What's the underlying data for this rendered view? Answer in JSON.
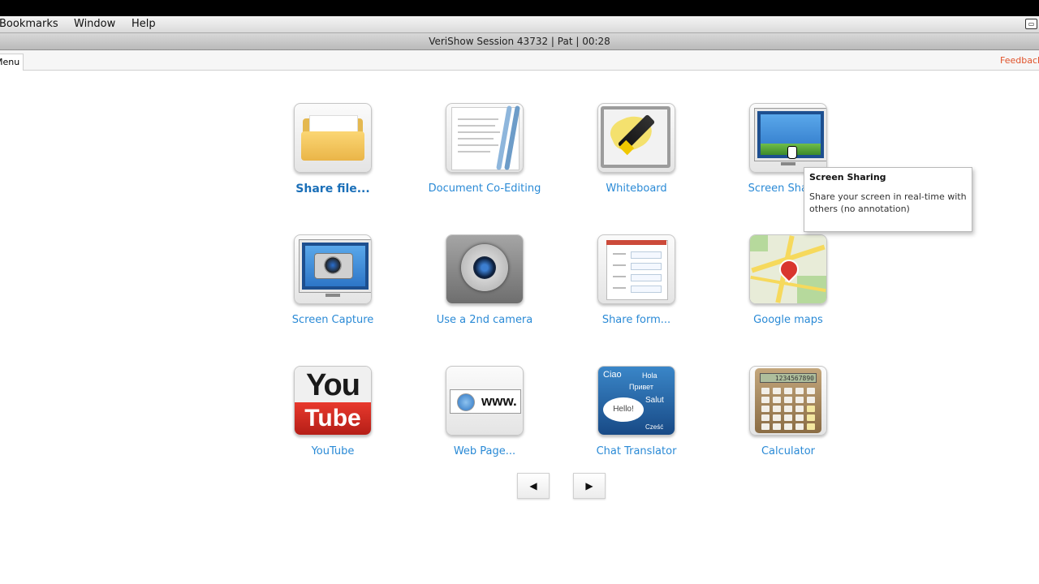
{
  "menubar": {
    "items": [
      "Bookmarks",
      "Window",
      "Help"
    ]
  },
  "titlebar": {
    "title": "VeriShow Session 43732 | Pat | 00:28"
  },
  "tabs": {
    "menu_label": "Menu",
    "feedback_label": "Feedback"
  },
  "apps": [
    {
      "label": "Share file...",
      "icon": "folder-icon"
    },
    {
      "label": "Document Co-Editing",
      "icon": "document-icon"
    },
    {
      "label": "Whiteboard",
      "icon": "whiteboard-icon"
    },
    {
      "label": "Screen Sharing",
      "icon": "monitor-icon"
    },
    {
      "label": "Screen Capture",
      "icon": "camera-screen-icon"
    },
    {
      "label": "Use a 2nd camera",
      "icon": "camera-lens-icon"
    },
    {
      "label": "Share form...",
      "icon": "form-icon"
    },
    {
      "label": "Google maps",
      "icon": "map-icon"
    },
    {
      "label": "YouTube",
      "icon": "youtube-icon"
    },
    {
      "label": "Web Page...",
      "icon": "web-page-icon"
    },
    {
      "label": "Chat Translator",
      "icon": "translator-icon"
    },
    {
      "label": "Calculator",
      "icon": "calculator-icon"
    }
  ],
  "icon_text": {
    "youtube_top": "You",
    "youtube_bottom": "Tube",
    "web": "www.",
    "translator_hello": "Hello!",
    "translator_words": [
      "Ciao",
      "Hola",
      "Привет",
      "Salut",
      "Cześć"
    ],
    "calculator_display": "1234567890"
  },
  "tooltip": {
    "title": "Screen Sharing",
    "body": "Share your screen in real-time with others (no annotation)"
  },
  "pager": {
    "prev": "◀",
    "next": "▶"
  },
  "colors": {
    "label_blue": "#2a8ad6",
    "feedback": "#e0522a"
  }
}
